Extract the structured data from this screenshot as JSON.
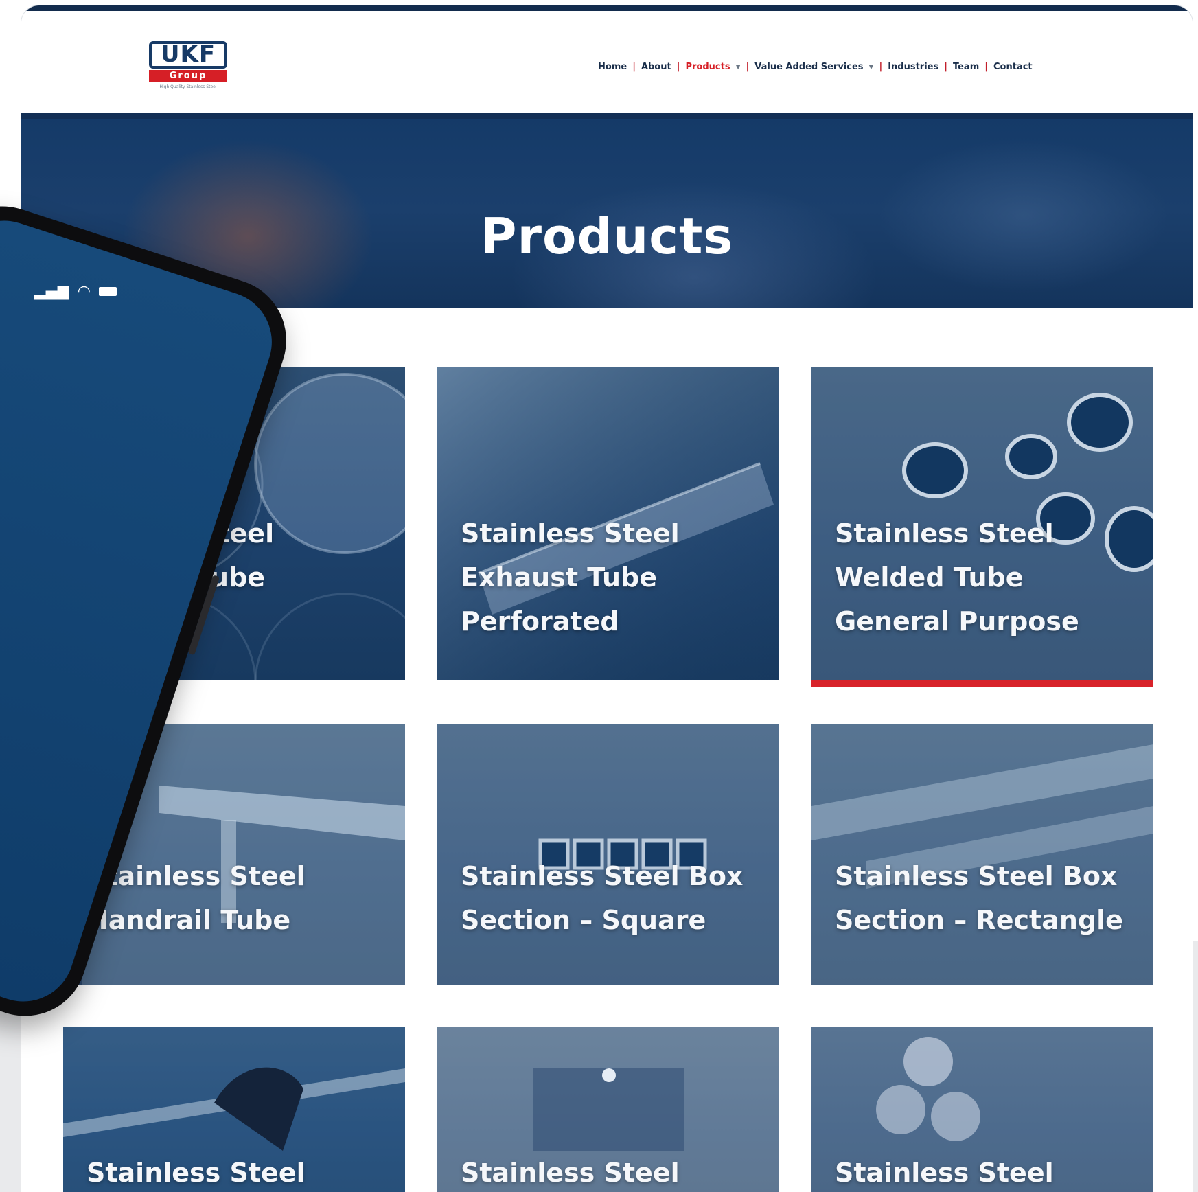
{
  "header": {
    "logo": {
      "brand": "UKF",
      "sub": "Group",
      "tagline": "High Quality Stainless Steel"
    },
    "nav": [
      {
        "label": "Home"
      },
      {
        "label": "About"
      },
      {
        "label": "Products",
        "active": true,
        "dropdown": true
      },
      {
        "label": "Value Added Services",
        "dropdown": true
      },
      {
        "label": "Industries"
      },
      {
        "label": "Team"
      },
      {
        "label": "Contact"
      }
    ]
  },
  "hero": {
    "title": "Products"
  },
  "products": [
    {
      "title": "ainless Steel\nxhaust Tube"
    },
    {
      "title": "Stainless Steel\nExhaust Tube\nPerforated"
    },
    {
      "title": "Stainless Steel\nWelded Tube\nGeneral Purpose"
    },
    {
      "title": "Stainless Steel\nHandrail Tube"
    },
    {
      "title": "Stainless Steel Box\nSection – Square"
    },
    {
      "title": "Stainless Steel Box\nSection – Rectangle"
    },
    {
      "title": "Stainless Steel"
    },
    {
      "title": "Stainless Steel"
    },
    {
      "title": "Stainless Steel"
    }
  ],
  "theme": {
    "navy": "#173a66",
    "red": "#d61f26"
  }
}
